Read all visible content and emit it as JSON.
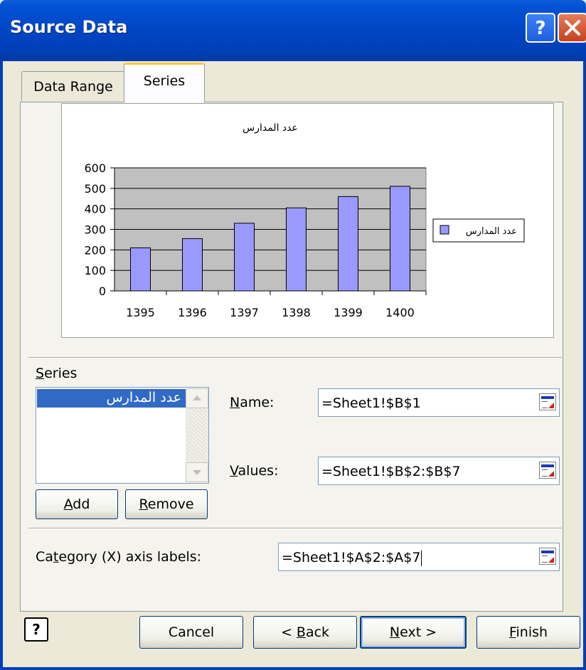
{
  "window": {
    "title": "Source Data"
  },
  "tabs": [
    {
      "label": "Data Range",
      "active": false
    },
    {
      "label": "Series",
      "active": true
    }
  ],
  "chart_data": {
    "type": "bar",
    "title": "عدد المدارس",
    "categories": [
      "1395",
      "1396",
      "1397",
      "1398",
      "1399",
      "1400"
    ],
    "series": [
      {
        "name": "عدد المدارس",
        "values": [
          210,
          255,
          330,
          405,
          460,
          510
        ]
      }
    ],
    "ylim": [
      0,
      600
    ],
    "yticks": [
      "0",
      "100",
      "200",
      "300",
      "400",
      "500",
      "600"
    ],
    "grid": true,
    "legend": "right",
    "bar_color": "#9999ff",
    "plot_background": "#c0c0c0"
  },
  "series_panel": {
    "label": "Series",
    "mnemonic": "S",
    "items": [
      "عدد المدارس"
    ],
    "selected": 0,
    "add_button": {
      "text": "Add",
      "mnemonic": "A"
    },
    "remove_button": {
      "text": "Remove",
      "mnemonic": "R"
    }
  },
  "fields": {
    "name": {
      "label": "Name:",
      "mnemonic": "N",
      "value": "=Sheet1!$B$1",
      "icon": "range-select-icon"
    },
    "values": {
      "label": "Values:",
      "mnemonic": "V",
      "value": "=Sheet1!$B$2:$B$7",
      "icon": "range-select-icon"
    },
    "category": {
      "label": "Category (X) axis labels:",
      "mnemonic": "t",
      "value": "=Sheet1!$A$2:$A$7",
      "icon": "range-select-icon"
    }
  },
  "footer": {
    "help_icon": "help-icon",
    "cancel": "Cancel",
    "back": {
      "text": "< Back",
      "mnemonic": "B"
    },
    "next": {
      "text": "Next >",
      "mnemonic": "N"
    },
    "finish": {
      "text": "Finish",
      "mnemonic": "F"
    }
  }
}
